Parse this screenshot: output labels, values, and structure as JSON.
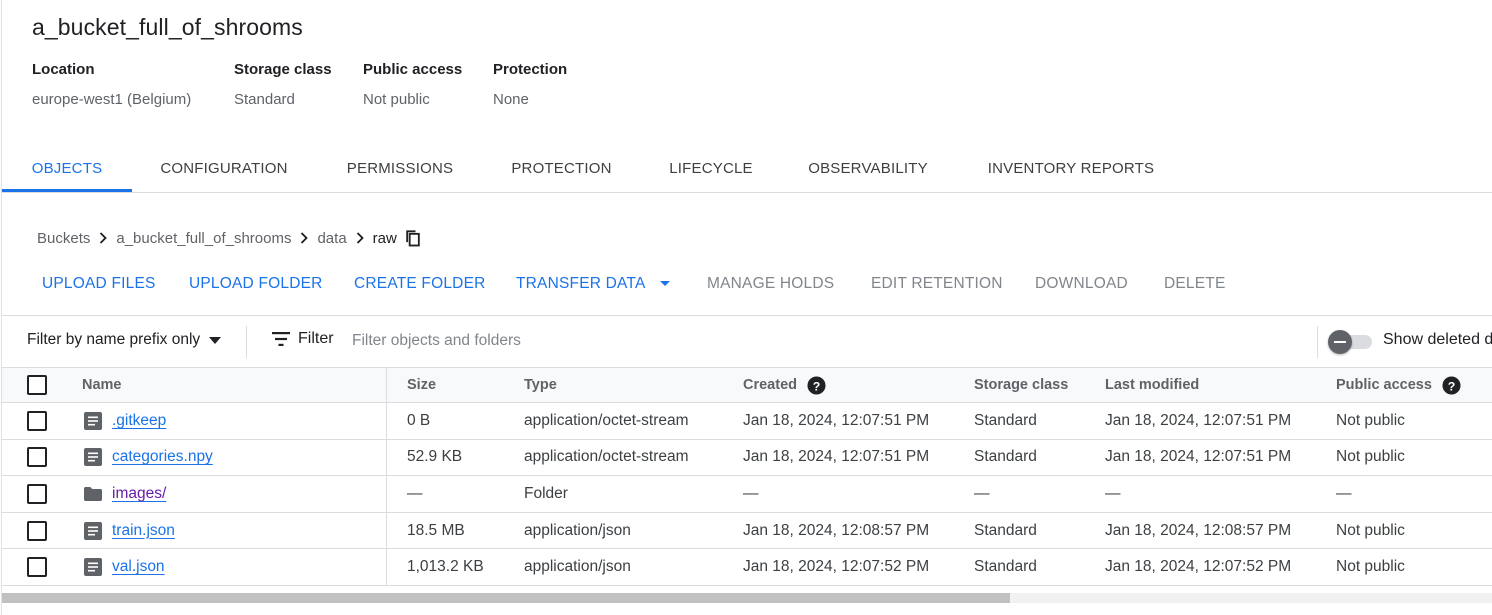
{
  "bucket": {
    "name": "a_bucket_full_of_shrooms",
    "meta": [
      {
        "label": "Location",
        "value": "europe-west1 (Belgium)"
      },
      {
        "label": "Storage class",
        "value": "Standard"
      },
      {
        "label": "Public access",
        "value": "Not public"
      },
      {
        "label": "Protection",
        "value": "None"
      }
    ]
  },
  "tabs": [
    {
      "label": "OBJECTS",
      "active": true
    },
    {
      "label": "CONFIGURATION",
      "active": false
    },
    {
      "label": "PERMISSIONS",
      "active": false
    },
    {
      "label": "PROTECTION",
      "active": false
    },
    {
      "label": "LIFECYCLE",
      "active": false
    },
    {
      "label": "OBSERVABILITY",
      "active": false
    },
    {
      "label": "INVENTORY REPORTS",
      "active": false
    }
  ],
  "breadcrumb": [
    "Buckets",
    "a_bucket_full_of_shrooms",
    "data",
    "raw"
  ],
  "actions": {
    "upload_files": "UPLOAD FILES",
    "upload_folder": "UPLOAD FOLDER",
    "create_folder": "CREATE FOLDER",
    "transfer_data": "TRANSFER DATA",
    "manage_holds": "MANAGE HOLDS",
    "edit_retention": "EDIT RETENTION",
    "download": "DOWNLOAD",
    "delete": "DELETE"
  },
  "filter": {
    "mode": "Filter by name prefix only",
    "button": "Filter",
    "placeholder": "Filter objects and folders",
    "show_deleted": "Show deleted d"
  },
  "table": {
    "columns": {
      "name": "Name",
      "size": "Size",
      "type": "Type",
      "created": "Created",
      "storage_class": "Storage class",
      "last_modified": "Last modified",
      "public_access": "Public access"
    },
    "rows": [
      {
        "name": ".gitkeep",
        "kind": "file",
        "size": "0 B",
        "type": "application/octet-stream",
        "created": "Jan 18, 2024, 12:07:51 PM",
        "storage_class": "Standard",
        "last_modified": "Jan 18, 2024, 12:07:51 PM",
        "public_access": "Not public"
      },
      {
        "name": "categories.npy",
        "kind": "file",
        "size": "52.9 KB",
        "type": "application/octet-stream",
        "created": "Jan 18, 2024, 12:07:51 PM",
        "storage_class": "Standard",
        "last_modified": "Jan 18, 2024, 12:07:51 PM",
        "public_access": "Not public"
      },
      {
        "name": "images/",
        "kind": "folder",
        "size": "—",
        "type": "Folder",
        "created": "—",
        "storage_class": "—",
        "last_modified": "—",
        "public_access": "—"
      },
      {
        "name": "train.json",
        "kind": "file",
        "size": "18.5 MB",
        "type": "application/json",
        "created": "Jan 18, 2024, 12:08:57 PM",
        "storage_class": "Standard",
        "last_modified": "Jan 18, 2024, 12:08:57 PM",
        "public_access": "Not public"
      },
      {
        "name": "val.json",
        "kind": "file",
        "size": "1,013.2 KB",
        "type": "application/json",
        "created": "Jan 18, 2024, 12:07:52 PM",
        "storage_class": "Standard",
        "last_modified": "Jan 18, 2024, 12:07:52 PM",
        "public_access": "Not public"
      }
    ]
  },
  "colors": {
    "accent": "#1a73e8",
    "link_visited": "#681da8",
    "disabled": "#80868b",
    "border": "#dadce0"
  }
}
